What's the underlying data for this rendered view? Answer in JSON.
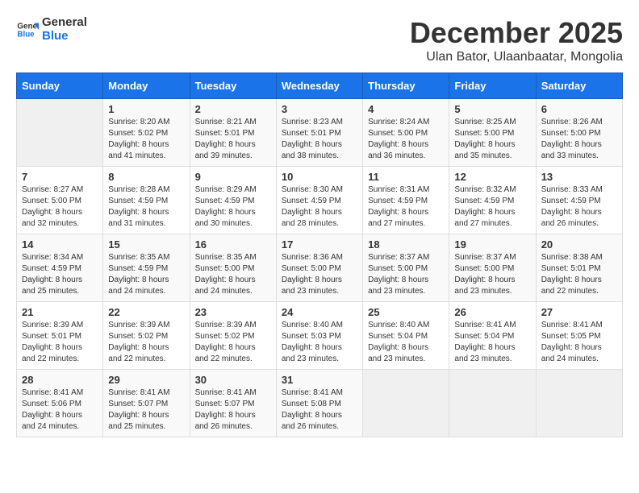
{
  "header": {
    "logo_line1": "General",
    "logo_line2": "Blue",
    "month_title": "December 2025",
    "subtitle": "Ulan Bator, Ulaanbaatar, Mongolia"
  },
  "weekdays": [
    "Sunday",
    "Monday",
    "Tuesday",
    "Wednesday",
    "Thursday",
    "Friday",
    "Saturday"
  ],
  "weeks": [
    [
      {
        "day": "",
        "info": ""
      },
      {
        "day": "1",
        "info": "Sunrise: 8:20 AM\nSunset: 5:02 PM\nDaylight: 8 hours\nand 41 minutes."
      },
      {
        "day": "2",
        "info": "Sunrise: 8:21 AM\nSunset: 5:01 PM\nDaylight: 8 hours\nand 39 minutes."
      },
      {
        "day": "3",
        "info": "Sunrise: 8:23 AM\nSunset: 5:01 PM\nDaylight: 8 hours\nand 38 minutes."
      },
      {
        "day": "4",
        "info": "Sunrise: 8:24 AM\nSunset: 5:00 PM\nDaylight: 8 hours\nand 36 minutes."
      },
      {
        "day": "5",
        "info": "Sunrise: 8:25 AM\nSunset: 5:00 PM\nDaylight: 8 hours\nand 35 minutes."
      },
      {
        "day": "6",
        "info": "Sunrise: 8:26 AM\nSunset: 5:00 PM\nDaylight: 8 hours\nand 33 minutes."
      }
    ],
    [
      {
        "day": "7",
        "info": "Sunrise: 8:27 AM\nSunset: 5:00 PM\nDaylight: 8 hours\nand 32 minutes."
      },
      {
        "day": "8",
        "info": "Sunrise: 8:28 AM\nSunset: 4:59 PM\nDaylight: 8 hours\nand 31 minutes."
      },
      {
        "day": "9",
        "info": "Sunrise: 8:29 AM\nSunset: 4:59 PM\nDaylight: 8 hours\nand 30 minutes."
      },
      {
        "day": "10",
        "info": "Sunrise: 8:30 AM\nSunset: 4:59 PM\nDaylight: 8 hours\nand 28 minutes."
      },
      {
        "day": "11",
        "info": "Sunrise: 8:31 AM\nSunset: 4:59 PM\nDaylight: 8 hours\nand 27 minutes."
      },
      {
        "day": "12",
        "info": "Sunrise: 8:32 AM\nSunset: 4:59 PM\nDaylight: 8 hours\nand 27 minutes."
      },
      {
        "day": "13",
        "info": "Sunrise: 8:33 AM\nSunset: 4:59 PM\nDaylight: 8 hours\nand 26 minutes."
      }
    ],
    [
      {
        "day": "14",
        "info": "Sunrise: 8:34 AM\nSunset: 4:59 PM\nDaylight: 8 hours\nand 25 minutes."
      },
      {
        "day": "15",
        "info": "Sunrise: 8:35 AM\nSunset: 4:59 PM\nDaylight: 8 hours\nand 24 minutes."
      },
      {
        "day": "16",
        "info": "Sunrise: 8:35 AM\nSunset: 5:00 PM\nDaylight: 8 hours\nand 24 minutes."
      },
      {
        "day": "17",
        "info": "Sunrise: 8:36 AM\nSunset: 5:00 PM\nDaylight: 8 hours\nand 23 minutes."
      },
      {
        "day": "18",
        "info": "Sunrise: 8:37 AM\nSunset: 5:00 PM\nDaylight: 8 hours\nand 23 minutes."
      },
      {
        "day": "19",
        "info": "Sunrise: 8:37 AM\nSunset: 5:00 PM\nDaylight: 8 hours\nand 23 minutes."
      },
      {
        "day": "20",
        "info": "Sunrise: 8:38 AM\nSunset: 5:01 PM\nDaylight: 8 hours\nand 22 minutes."
      }
    ],
    [
      {
        "day": "21",
        "info": "Sunrise: 8:39 AM\nSunset: 5:01 PM\nDaylight: 8 hours\nand 22 minutes."
      },
      {
        "day": "22",
        "info": "Sunrise: 8:39 AM\nSunset: 5:02 PM\nDaylight: 8 hours\nand 22 minutes."
      },
      {
        "day": "23",
        "info": "Sunrise: 8:39 AM\nSunset: 5:02 PM\nDaylight: 8 hours\nand 22 minutes."
      },
      {
        "day": "24",
        "info": "Sunrise: 8:40 AM\nSunset: 5:03 PM\nDaylight: 8 hours\nand 23 minutes."
      },
      {
        "day": "25",
        "info": "Sunrise: 8:40 AM\nSunset: 5:04 PM\nDaylight: 8 hours\nand 23 minutes."
      },
      {
        "day": "26",
        "info": "Sunrise: 8:41 AM\nSunset: 5:04 PM\nDaylight: 8 hours\nand 23 minutes."
      },
      {
        "day": "27",
        "info": "Sunrise: 8:41 AM\nSunset: 5:05 PM\nDaylight: 8 hours\nand 24 minutes."
      }
    ],
    [
      {
        "day": "28",
        "info": "Sunrise: 8:41 AM\nSunset: 5:06 PM\nDaylight: 8 hours\nand 24 minutes."
      },
      {
        "day": "29",
        "info": "Sunrise: 8:41 AM\nSunset: 5:07 PM\nDaylight: 8 hours\nand 25 minutes."
      },
      {
        "day": "30",
        "info": "Sunrise: 8:41 AM\nSunset: 5:07 PM\nDaylight: 8 hours\nand 26 minutes."
      },
      {
        "day": "31",
        "info": "Sunrise: 8:41 AM\nSunset: 5:08 PM\nDaylight: 8 hours\nand 26 minutes."
      },
      {
        "day": "",
        "info": ""
      },
      {
        "day": "",
        "info": ""
      },
      {
        "day": "",
        "info": ""
      }
    ]
  ]
}
